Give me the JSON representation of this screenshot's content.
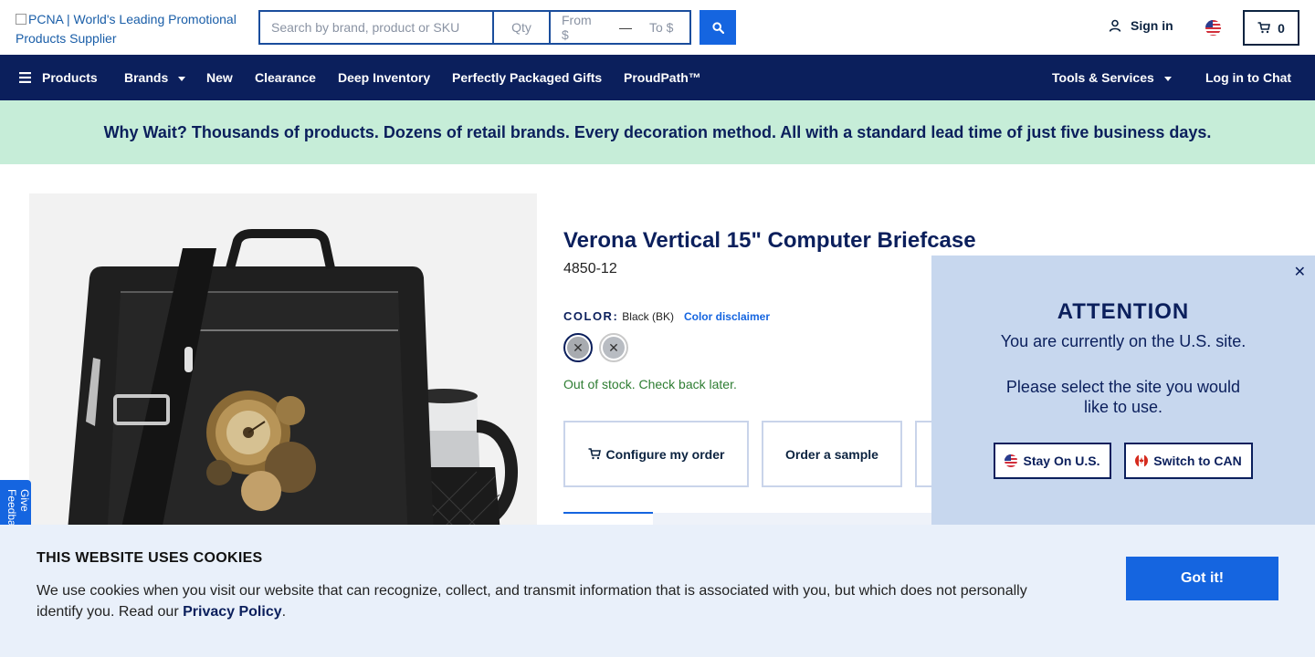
{
  "header": {
    "logo_alt": "PCNA | World's Leading Promotional Products Supplier",
    "search": {
      "placeholder": "Search by brand, product or SKU",
      "qty_placeholder": "Qty",
      "from_placeholder": "From $",
      "dash": "—",
      "to_placeholder": "To $"
    },
    "signin_label": "Sign in",
    "cart_count": "0"
  },
  "nav": {
    "items": [
      {
        "label": "Products"
      },
      {
        "label": "Brands"
      },
      {
        "label": "New"
      },
      {
        "label": "Clearance"
      },
      {
        "label": "Deep Inventory"
      },
      {
        "label": "Perfectly Packaged Gifts"
      },
      {
        "label": "ProudPath™"
      }
    ],
    "tools_label": "Tools & Services",
    "chat_label": "Log in to Chat"
  },
  "promo": {
    "text": "Why Wait? Thousands of products. Dozens of retail brands. Every decoration method. All with a standard lead time of just five business days."
  },
  "product": {
    "title": "Verona Vertical 15\" Computer Briefcase",
    "sku": "4850-12",
    "color_label": "COLOR:",
    "color_value": "Black (BK)",
    "color_disclaimer": "Color disclaimer",
    "stock_status": "Out of stock. Check back later.",
    "actions": {
      "configure": "Configure my order",
      "sample": "Order a sample"
    }
  },
  "feedback": {
    "label": "Give Feedback"
  },
  "site_modal": {
    "title": "ATTENTION",
    "line1": "You are currently on the U.S. site.",
    "line2": "Please select the site you would like to use.",
    "stay_label": "Stay On U.S.",
    "switch_label": "Switch to CAN"
  },
  "cookie": {
    "title": "THIS WEBSITE USES COOKIES",
    "text_before": "We use cookies when you visit our website that can recognize, collect, and transmit information that is associated with you, but which does not personally identify you. Read our ",
    "link": "Privacy Policy",
    "text_after": ".",
    "button": "Got it!"
  },
  "colors": {
    "brand_navy": "#0b1f5c",
    "accent_blue": "#1565e0",
    "promo_green": "#c6edd8",
    "stock_green": "#2e7d32"
  }
}
